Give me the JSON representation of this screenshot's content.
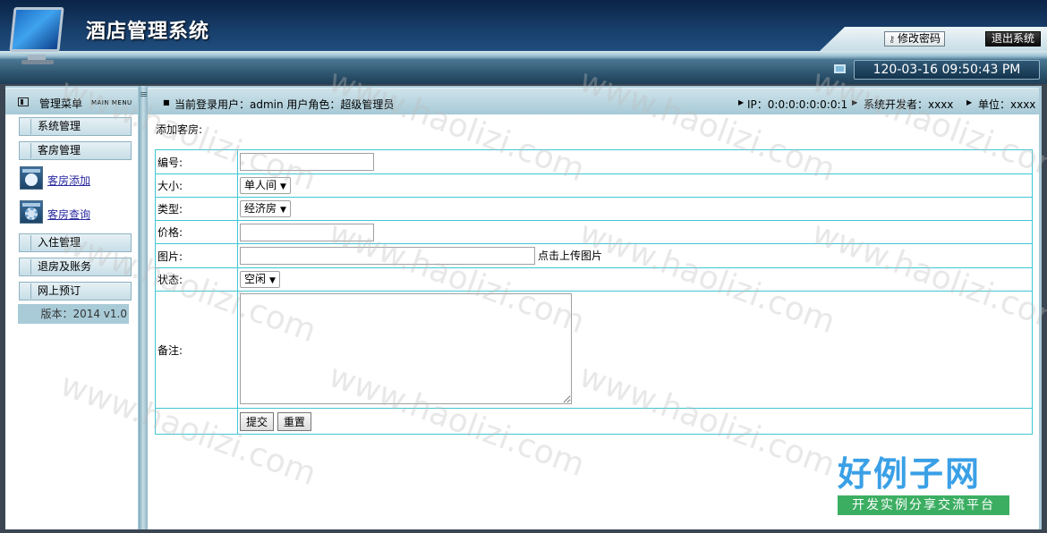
{
  "header": {
    "app_title": "酒店管理系统",
    "change_password_label": "修改密码",
    "exit_label": "退出系统",
    "clock_text": "120-03-16 09:50:43 PM"
  },
  "sidebar": {
    "title": "管理菜单",
    "title_en": "MAIN MENU",
    "menu_items": [
      {
        "label": "系统管理"
      },
      {
        "label": "客房管理"
      },
      {
        "label": "入住管理"
      },
      {
        "label": "退房及账务"
      },
      {
        "label": "网上预订"
      }
    ],
    "sub_items": [
      {
        "label": "客房添加",
        "icon": "room-add-icon"
      },
      {
        "label": "客房查询",
        "icon": "room-query-icon"
      }
    ],
    "version": "版本：2014 v1.0"
  },
  "infobar": {
    "current_user": "当前登录用户：admin  用户角色：超级管理员",
    "ip": "IP：0:0:0:0:0:0:0:1",
    "developer": "系统开发者：xxxx",
    "unit": "单位：xxxx"
  },
  "main": {
    "page_label": "添加客房:",
    "form": {
      "number_label": "编号:",
      "number_value": "",
      "size_label": "大小:",
      "size_value": "单人间",
      "type_label": "类型:",
      "type_value": "经济房",
      "price_label": "价格:",
      "price_value": "",
      "image_label": "图片:",
      "image_value": "",
      "upload_text": "点击上传图片",
      "status_label": "状态:",
      "status_value": "空闲",
      "remark_label": "备注:",
      "remark_value": "",
      "submit_label": "提交",
      "reset_label": "重置"
    }
  },
  "watermark": {
    "text": "www.haolizi.com",
    "brand_big": "好例子网",
    "brand_small": "开发实例分享交流平台"
  },
  "colors": {
    "header_dark": "#17426e",
    "panel_blue": "#a9cbd8",
    "table_border": "#40c6d2",
    "link": "#2a2aa0",
    "brand_blue": "#3aa0e6",
    "brand_green": "#3cae62"
  }
}
